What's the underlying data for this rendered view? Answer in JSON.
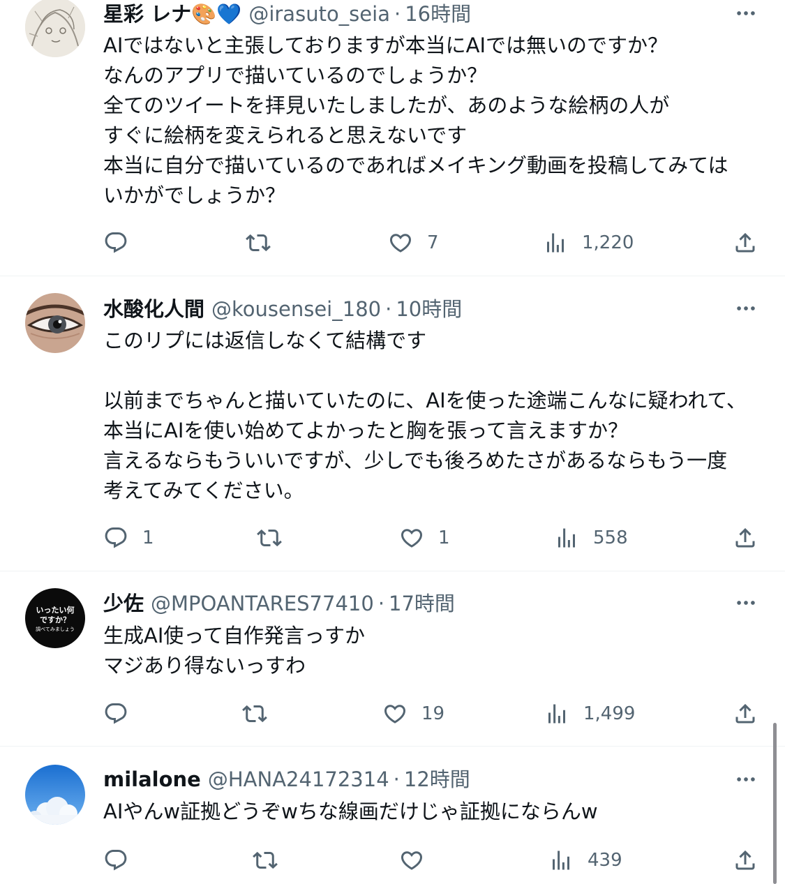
{
  "tweets": [
    {
      "name": "星彩 レナ🎨💙",
      "handle": "@irasuto_seia",
      "time": "16時間",
      "text": "AIではないと主張しておりますが本当にAIでは無いのですか？\nなんのアプリで描いているのでしょうか？\n全てのツイートを拝見いたしましたが、あのような絵柄の人が\nすぐに絵柄を変えられると思えないです\n本当に自分で描いているのであればメイキング動画を投稿してみては\nいかがでしょうか？",
      "replies": "",
      "retweets": "",
      "likes": "7",
      "views": "1,220",
      "avatar_icon": "sketch-avatar-icon"
    },
    {
      "name": "水酸化人間",
      "handle": "@kousensei_180",
      "time": "10時間",
      "text": "このリプには返信しなくて結構です\n\n以前までちゃんと描いていたのに、AIを使った途端こんなに疑われて、\n本当にAIを使い始めてよかったと胸を張って言えますか？\n言えるならもういいですが、少しでも後ろめたさがあるならもう一度\n考えてみてください。",
      "replies": "1",
      "retweets": "",
      "likes": "1",
      "views": "558",
      "avatar_icon": "eye-avatar-icon"
    },
    {
      "name": "少佐",
      "handle": "@MPOANTARES77410",
      "time": "17時間",
      "text": "生成AI使って自作発言っすか\nマジあり得ないっすわ",
      "replies": "",
      "retweets": "",
      "likes": "19",
      "views": "1,499",
      "avatar_icon": "text-avatar-icon",
      "avatar_text": {
        "line1": "いったい何",
        "line2": "ですか？",
        "line3": "調べてみましょう"
      }
    },
    {
      "name": "milalone",
      "handle": "@HANA24172314",
      "time": "12時間",
      "text": "AIやんw証拠どうぞwちな線画だけじゃ証拠にならんw",
      "replies": "",
      "retweets": "",
      "likes": "",
      "views": "439",
      "avatar_icon": "sky-avatar-icon"
    }
  ],
  "icons": {
    "reply": "reply-icon",
    "retweet": "retweet-icon",
    "like": "heart-icon",
    "views": "views-icon",
    "share": "share-icon",
    "more": "more-icon"
  },
  "colors": {
    "text": "#0f1419",
    "secondary": "#536471",
    "divider": "#eff3f4",
    "background": "#ffffff"
  }
}
